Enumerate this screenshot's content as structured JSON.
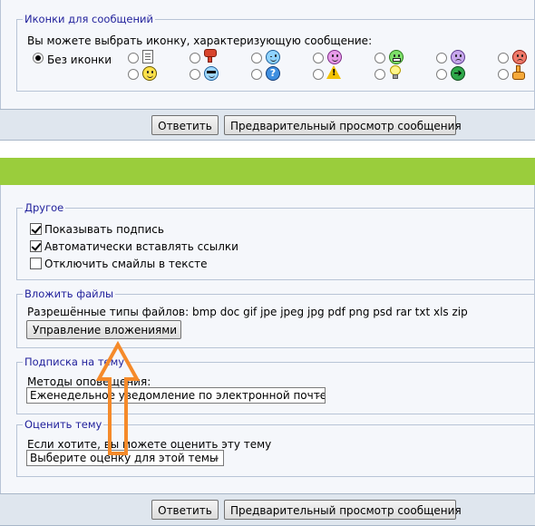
{
  "icons_section": {
    "legend": "Иконки для сообщений",
    "prompt": "Вы можете выбрать иконку, характеризующую сообщение:",
    "no_icon_label": "Без иконки",
    "row1": [
      "paper-icon",
      "thumbs-down-icon",
      "wink-icon",
      "tongue-icon",
      "grin-icon",
      "frown-icon",
      "angry-icon"
    ],
    "row2": [
      "smile-icon",
      "cool-icon",
      "question-icon",
      "warning-icon",
      "lightbulb-icon",
      "arrow-icon",
      "thumbs-up-icon"
    ]
  },
  "actions": {
    "reply_label": "Ответить",
    "preview_label": "Предварительный просмотр сообщения"
  },
  "other_section": {
    "legend": "Другое",
    "options": [
      {
        "label": "Показывать подпись",
        "checked": true
      },
      {
        "label": "Автоматически вставлять ссылки",
        "checked": true
      },
      {
        "label": "Отключить смайлы в тексте",
        "checked": false
      }
    ]
  },
  "attach_section": {
    "legend": "Вложить файлы",
    "allowed_types": "Разрешённые типы файлов: bmp doc gif jpe jpeg jpg pdf png psd rar txt xls zip",
    "manage_label": "Управление вложениями"
  },
  "subscribe_section": {
    "legend": "Подписка на тему",
    "methods_label": "Методы оповещения:",
    "selected": "Еженедельное уведомление по электронной почте"
  },
  "rate_section": {
    "legend": "Оценить тему",
    "prompt": "Если хотите, вы можете оценить эту тему",
    "selected": "Выберите оценку для этой темы"
  },
  "colors": {
    "accent_green": "#9acd3c",
    "annotation_arrow": "#f58a2a",
    "legend_blue": "#22229c"
  }
}
